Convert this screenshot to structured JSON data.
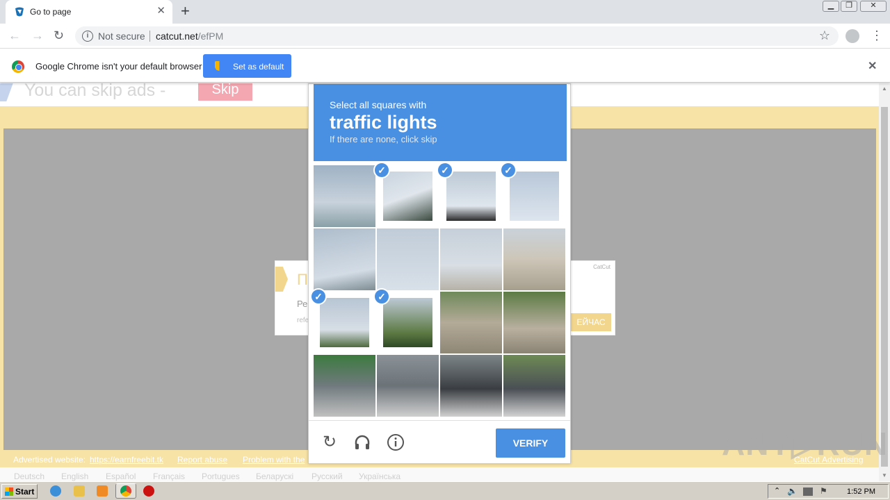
{
  "browser": {
    "tab_title": "Go to page",
    "new_tab": "+",
    "url_warning": "Not secure",
    "url_host": "catcut.net",
    "url_path": "/efPM",
    "window_buttons": [
      "▁",
      "❐",
      "✕"
    ]
  },
  "infobar": {
    "message": "Google Chrome isn't your default browser",
    "button": "Set as default"
  },
  "page": {
    "skip_text": "You can skip ads  -",
    "skip_button": "Skip",
    "ad_title": "П",
    "ad_line1": "Ре",
    "ad_line2": "refe",
    "ad_cta": "ЕЙЧАС",
    "ad_brand": "CatCut",
    "footer": {
      "advertised_label": "Advertised website:",
      "advertised_link": "https://earnfreebit.tk",
      "report": "Report abuse",
      "problem": "Problem with the",
      "brand": "CatCut Advertising"
    },
    "languages": [
      "Deutsch",
      "English",
      "Español",
      "Français",
      "Portugues",
      "Беларускі",
      "Русский",
      "Українська"
    ]
  },
  "captcha": {
    "instruction": "Select all squares with",
    "target": "traffic lights",
    "hint": "If there are none, click skip",
    "verify": "VERIFY",
    "selected_tiles": [
      1,
      2,
      3,
      8,
      9
    ],
    "tile_count": 16
  },
  "watermark": "ANY▷RUN",
  "taskbar": {
    "start": "Start",
    "time": "1:52 PM"
  }
}
